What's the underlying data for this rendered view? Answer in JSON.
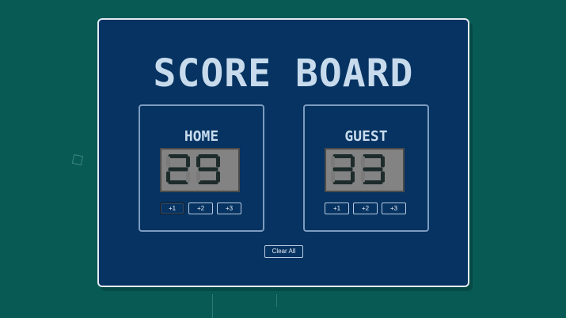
{
  "title": "SCORE BOARD",
  "home": {
    "name": "HOME",
    "score": "29",
    "buttons": [
      "+1",
      "+2",
      "+3"
    ]
  },
  "guest": {
    "name": "GUEST",
    "score": "33",
    "buttons": [
      "+1",
      "+2",
      "+3"
    ]
  },
  "clear_label": "Clear All",
  "colors": {
    "background": "#085a55",
    "board": "#063361",
    "text": "#c7dbed",
    "display": "#838383",
    "segment_on": "#1d2b2b",
    "segment_off": "#7a7a7a"
  }
}
